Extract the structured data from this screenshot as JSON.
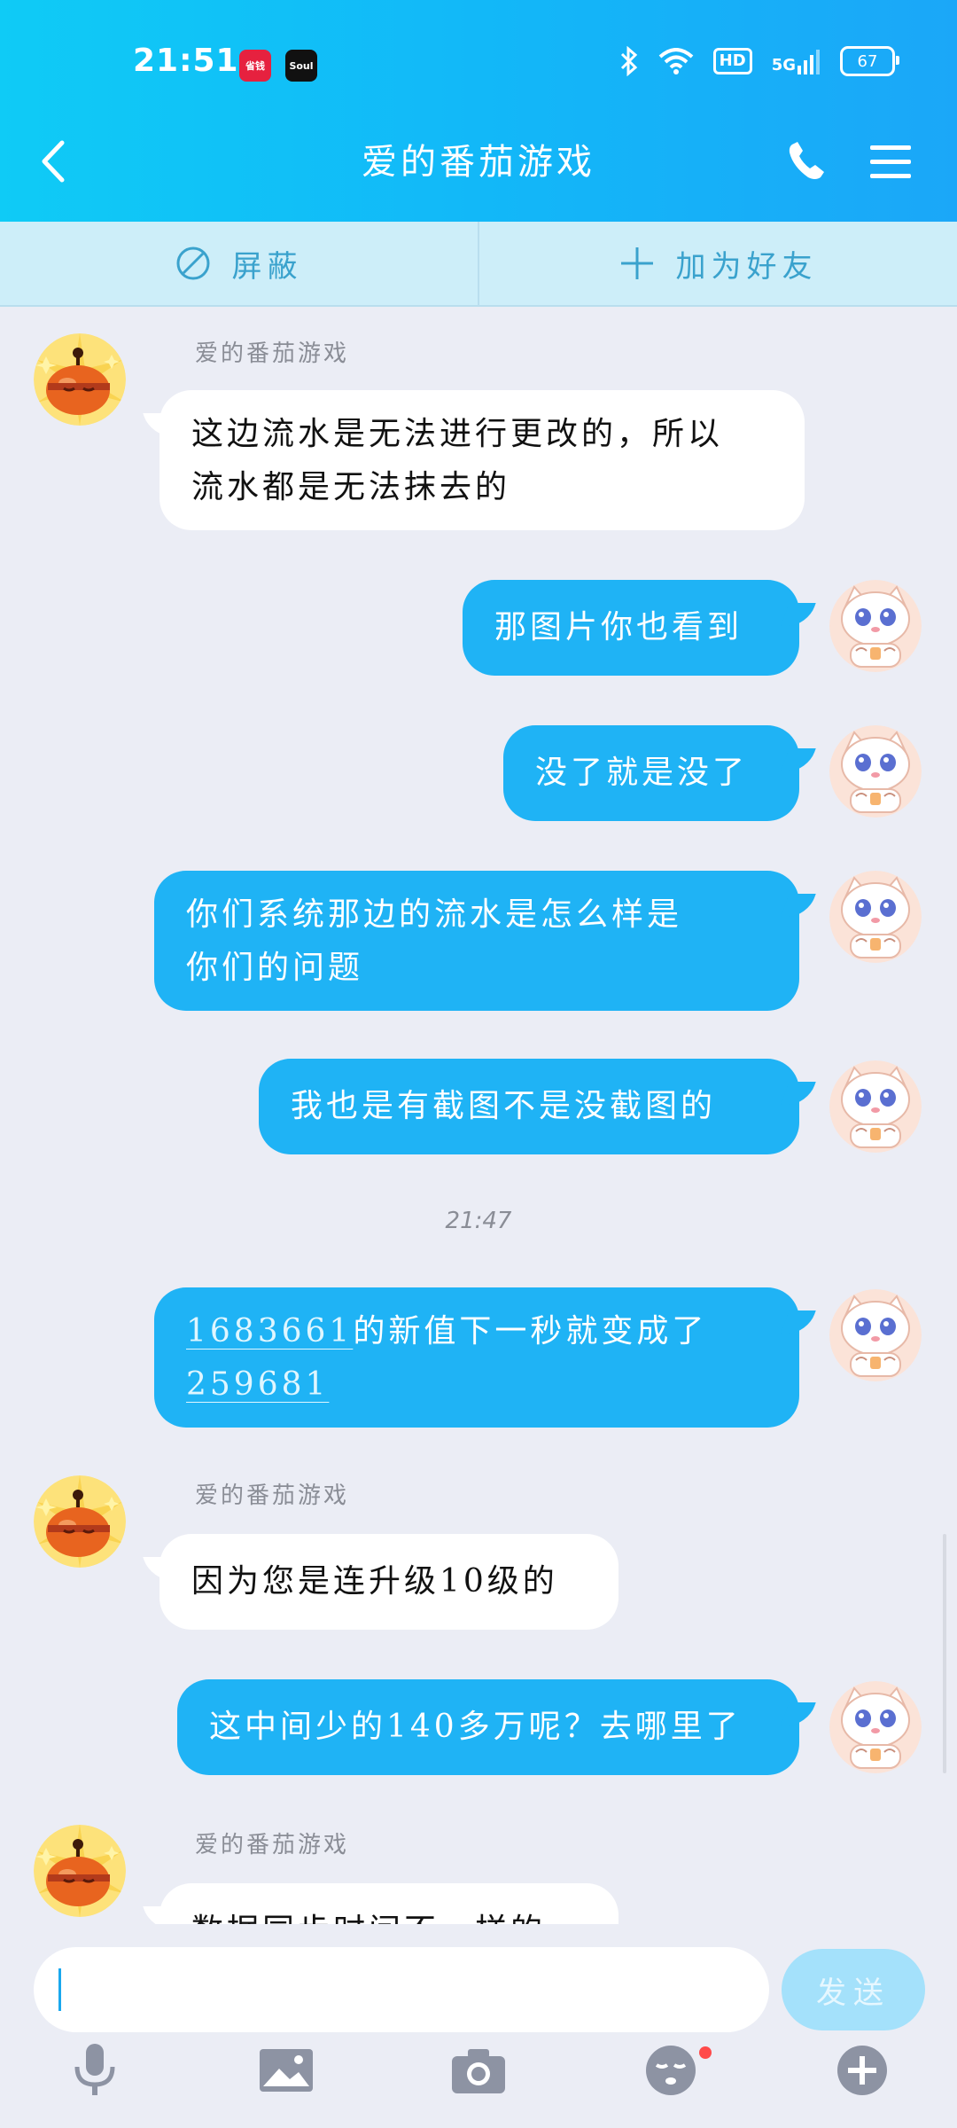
{
  "status_bar": {
    "time": "21:51",
    "app_icons": [
      {
        "name": "shengqian-app-icon",
        "label": "省钱",
        "color": "#e6213f"
      },
      {
        "name": "soul-app-icon",
        "label": "Soul",
        "color": "#111111"
      }
    ],
    "hd": "HD",
    "network": "5G",
    "battery": "67"
  },
  "header": {
    "title": "爱的番茄游戏",
    "back_icon": "chevron-left-icon",
    "call_icon": "phone-icon",
    "menu_icon": "hamburger-menu-icon"
  },
  "action_bar": {
    "block_label": "屏蔽",
    "add_friend_label": "加为好友"
  },
  "messages": [
    {
      "type": "in",
      "sender": "爱的番茄游戏",
      "lines": [
        "这边流水是无法进行更改的，所以",
        "流水都是无法抹去的"
      ]
    },
    {
      "type": "out",
      "lines": [
        "那图片你也看到"
      ]
    },
    {
      "type": "out",
      "lines": [
        "没了就是没了"
      ]
    },
    {
      "type": "out",
      "lines": [
        "你们系统那边的流水是怎么样是",
        "你们的问题"
      ]
    },
    {
      "type": "out",
      "lines": [
        "我也是有截图不是没截图的"
      ]
    },
    {
      "type": "time",
      "text": "21:47"
    },
    {
      "type": "out",
      "link1": "1683661",
      "text1": "的新值下一秒就变成了",
      "link2": "259681"
    },
    {
      "type": "in",
      "sender": "爱的番茄游戏",
      "lines": [
        "因为您是连升级10级的"
      ]
    },
    {
      "type": "out",
      "lines": [
        "这中间少的140多万呢？去哪里了"
      ]
    },
    {
      "type": "in",
      "sender": "爱的番茄游戏",
      "lines": [
        "数据同步时间不一样的"
      ]
    }
  ],
  "input": {
    "value": "",
    "send_label": "发送"
  },
  "toolbar": [
    "microphone-icon",
    "image-icon",
    "camera-icon",
    "emoji-icon",
    "plus-icon"
  ],
  "colors": {
    "header": "#12b8f8",
    "outgoing_bubble": "#1fb3f5",
    "incoming_bubble": "#ffffff",
    "background": "#ebedf5"
  }
}
